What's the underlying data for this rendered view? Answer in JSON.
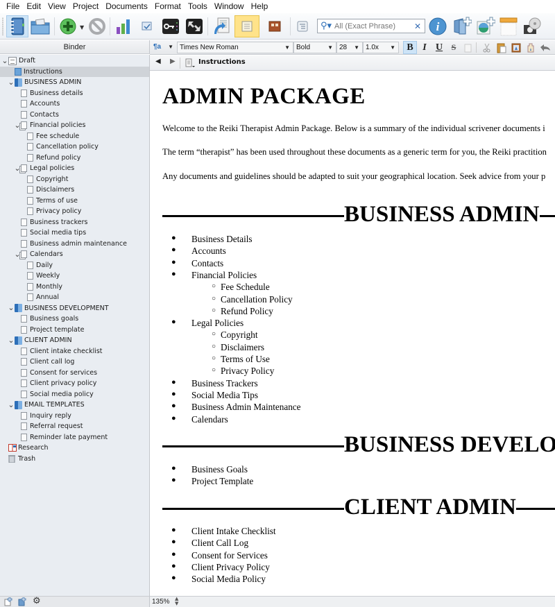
{
  "menu": [
    "File",
    "Edit",
    "View",
    "Project",
    "Documents",
    "Format",
    "Tools",
    "Window",
    "Help"
  ],
  "toolbar": {
    "search_placeholder": "All (Exact Phrase)",
    "icons": [
      "binder-icon",
      "collections-icon",
      "add-icon",
      "delete-icon",
      "project-targets-icon",
      "checkbox-icon",
      "keywords-icon",
      "fullscreen-icon",
      "compile-icon",
      "scrivenings-icon",
      "corkboard-icon",
      "outliner-icon",
      "info-icon",
      "new-folder-icon",
      "new-image-icon",
      "ruler-icon",
      "snapshot-icon"
    ]
  },
  "binder": {
    "header": "Binder",
    "items": [
      {
        "label": "Draft",
        "level": 0,
        "type": "draft",
        "expanded": true
      },
      {
        "label": "Instructions",
        "level": 1,
        "type": "instr",
        "selected": true
      },
      {
        "label": "BUSINESS ADMIN",
        "level": 1,
        "type": "folder",
        "expanded": true
      },
      {
        "label": "Business details",
        "level": 2,
        "type": "doc"
      },
      {
        "label": "Accounts",
        "level": 2,
        "type": "doc"
      },
      {
        "label": "Contacts",
        "level": 2,
        "type": "doc"
      },
      {
        "label": "Financial policies",
        "level": 2,
        "type": "stack",
        "expanded": true
      },
      {
        "label": "Fee schedule",
        "level": 3,
        "type": "doc"
      },
      {
        "label": "Cancellation policy",
        "level": 3,
        "type": "doc"
      },
      {
        "label": "Refund policy",
        "level": 3,
        "type": "doc"
      },
      {
        "label": "Legal policies",
        "level": 2,
        "type": "stack",
        "expanded": true
      },
      {
        "label": "Copyright",
        "level": 3,
        "type": "doc"
      },
      {
        "label": "Disclaimers",
        "level": 3,
        "type": "doc"
      },
      {
        "label": "Terms of use",
        "level": 3,
        "type": "doc"
      },
      {
        "label": "Privacy policy",
        "level": 3,
        "type": "doc"
      },
      {
        "label": "Business trackers",
        "level": 2,
        "type": "doc"
      },
      {
        "label": "Social media tips",
        "level": 2,
        "type": "doc"
      },
      {
        "label": "Business admin maintenance",
        "level": 2,
        "type": "doc"
      },
      {
        "label": "Calendars",
        "level": 2,
        "type": "stack",
        "expanded": true
      },
      {
        "label": "Daily",
        "level": 3,
        "type": "doc"
      },
      {
        "label": "Weekly",
        "level": 3,
        "type": "doc"
      },
      {
        "label": "Monthly",
        "level": 3,
        "type": "doc"
      },
      {
        "label": "Annual",
        "level": 3,
        "type": "doc"
      },
      {
        "label": "BUSINESS DEVELOPMENT",
        "level": 1,
        "type": "folder",
        "expanded": true
      },
      {
        "label": "Business goals",
        "level": 2,
        "type": "doc"
      },
      {
        "label": "Project template",
        "level": 2,
        "type": "doc"
      },
      {
        "label": "CLIENT ADMIN",
        "level": 1,
        "type": "folder",
        "expanded": true
      },
      {
        "label": "Client intake checklist",
        "level": 2,
        "type": "doc"
      },
      {
        "label": "Client call log",
        "level": 2,
        "type": "doc"
      },
      {
        "label": "Consent for services",
        "level": 2,
        "type": "doc"
      },
      {
        "label": "Client privacy policy",
        "level": 2,
        "type": "doc"
      },
      {
        "label": "Social media policy",
        "level": 2,
        "type": "doc"
      },
      {
        "label": "EMAIL TEMPLATES",
        "level": 1,
        "type": "folder",
        "expanded": true
      },
      {
        "label": "Inquiry reply",
        "level": 2,
        "type": "doc"
      },
      {
        "label": "Referral request",
        "level": 2,
        "type": "doc"
      },
      {
        "label": "Reminder late payment",
        "level": 2,
        "type": "doc"
      },
      {
        "label": "Research",
        "level": 0,
        "type": "research"
      },
      {
        "label": "Trash",
        "level": 0,
        "type": "trash"
      }
    ]
  },
  "formatbar": {
    "style_icon": "¶a",
    "font": "Times New Roman",
    "weight": "Bold",
    "size": "28",
    "spacing": "1.0x",
    "bold": "B",
    "italic": "I",
    "underline": "U",
    "strike": "S"
  },
  "docnav": {
    "title": "Instructions"
  },
  "document": {
    "title": "ADMIN PACKAGE",
    "paragraphs": [
      "Welcome to the Reiki Therapist Admin Package. Below is a summary of the individual scrivener documents i",
      "The term “therapist” has been used throughout these documents as a generic term for you, the Reiki practition",
      "Any documents and guidelines should be adapted to suit your geographical location. Seek advice from your p"
    ],
    "sections": [
      {
        "heading": "BUSINESS ADMIN",
        "items": [
          {
            "text": "Business Details",
            "sub": false
          },
          {
            "text": "Accounts",
            "sub": false
          },
          {
            "text": "Contacts",
            "sub": false
          },
          {
            "text": "Financial Policies",
            "sub": false
          },
          {
            "text": "Fee Schedule",
            "sub": true
          },
          {
            "text": "Cancellation Policy",
            "sub": true
          },
          {
            "text": "Refund Policy",
            "sub": true
          },
          {
            "text": "Legal Policies",
            "sub": false
          },
          {
            "text": "Copyright",
            "sub": true
          },
          {
            "text": "Disclaimers",
            "sub": true
          },
          {
            "text": "Terms of Use",
            "sub": true
          },
          {
            "text": "Privacy Policy",
            "sub": true
          },
          {
            "text": "Business Trackers",
            "sub": false
          },
          {
            "text": "Social Media Tips",
            "sub": false
          },
          {
            "text": "Business Admin Maintenance",
            "sub": false
          },
          {
            "text": "Calendars",
            "sub": false
          }
        ]
      },
      {
        "heading": "BUSINESS DEVELO",
        "items": [
          {
            "text": "Business Goals",
            "sub": false
          },
          {
            "text": "Project Template",
            "sub": false
          }
        ]
      },
      {
        "heading": "CLIENT ADMIN",
        "items": [
          {
            "text": "Client Intake Checklist",
            "sub": false
          },
          {
            "text": "Client Call Log",
            "sub": false
          },
          {
            "text": "Consent for Services",
            "sub": false
          },
          {
            "text": "Client Privacy Policy",
            "sub": false
          },
          {
            "text": "Social Media Policy",
            "sub": false
          }
        ]
      }
    ]
  },
  "footer": {
    "zoom": "135%"
  }
}
